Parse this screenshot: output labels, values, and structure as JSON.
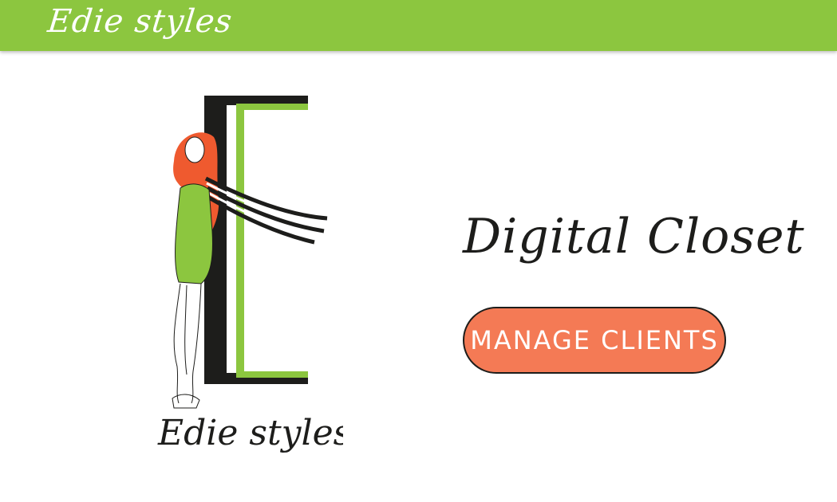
{
  "header": {
    "brand": "Edie styles"
  },
  "logo": {
    "wordmark": "Edie styles"
  },
  "main": {
    "title": "Digital Closet",
    "manage_button": "MANAGE CLIENTS"
  },
  "colors": {
    "header_green": "#8cc63f",
    "button_coral": "#f47a55",
    "ink": "#1d1d1b",
    "hair_orange": "#ef5a2f"
  }
}
